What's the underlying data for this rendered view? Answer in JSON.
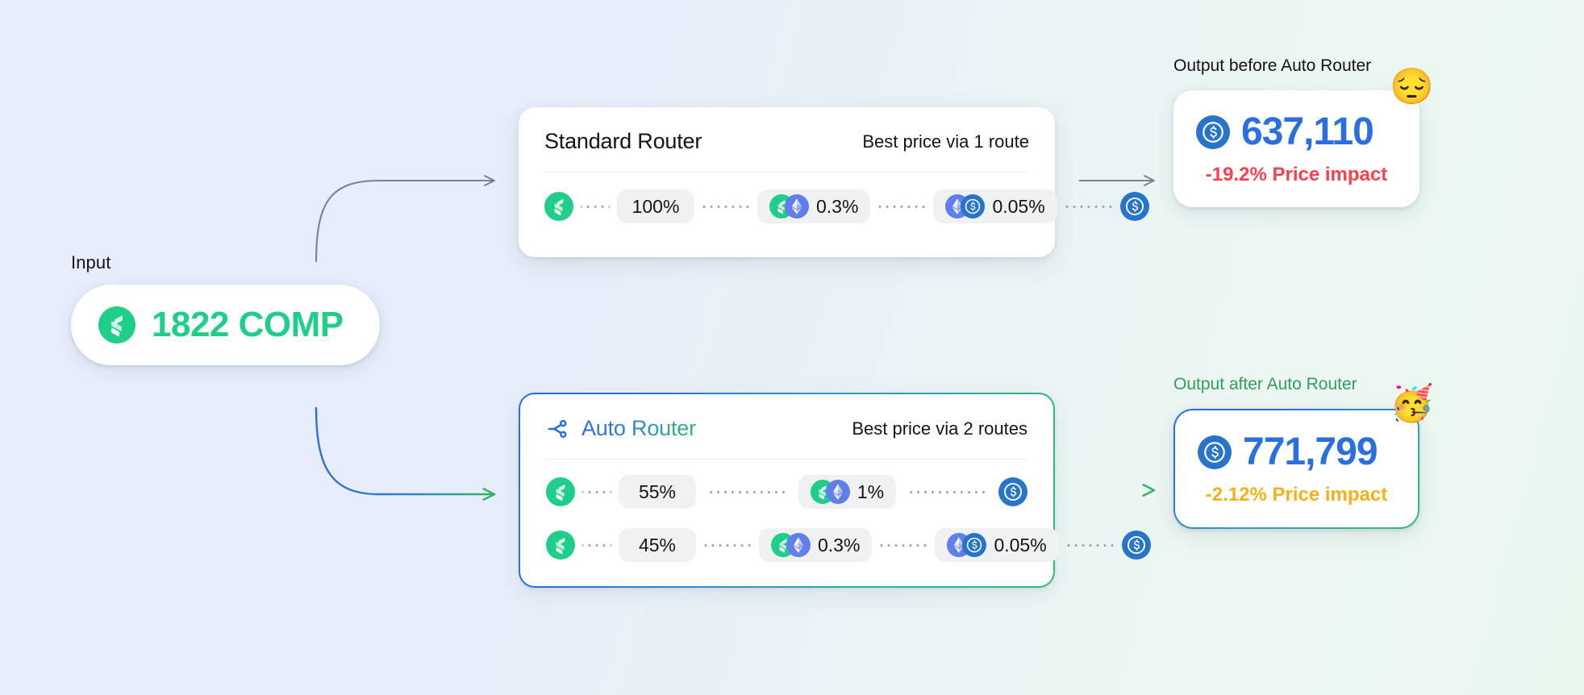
{
  "background": {
    "left_color": "#e7edfb",
    "right_color": "#eaf7ef"
  },
  "input": {
    "label": "Input",
    "amount": "1822 COMP",
    "token_icon": "comp-token-icon"
  },
  "standard_router": {
    "title": "Standard Router",
    "subtitle": "Best price via 1 route",
    "routes": [
      {
        "start_icon": "comp-token-icon",
        "share": "100%",
        "hops": [
          {
            "icons": [
              "comp-token-icon",
              "eth-token-icon"
            ],
            "fee": "0.3%"
          },
          {
            "icons": [
              "eth-token-icon",
              "usdc-token-icon"
            ],
            "fee": "0.05%"
          }
        ],
        "end_icon": "usdc-token-icon"
      }
    ]
  },
  "auto_router": {
    "title": "Auto Router",
    "title_icon": "share-split-icon",
    "subtitle": "Best price via 2 routes",
    "accent_start": "#2a6fe0",
    "accent_end": "#2fbf6e",
    "routes": [
      {
        "start_icon": "comp-token-icon",
        "share": "55%",
        "hops": [
          {
            "icons": [
              "comp-token-icon",
              "eth-token-icon"
            ],
            "fee": "1%"
          }
        ],
        "end_icon": "usdc-token-icon"
      },
      {
        "start_icon": "comp-token-icon",
        "share": "45%",
        "hops": [
          {
            "icons": [
              "comp-token-icon",
              "eth-token-icon"
            ],
            "fee": "0.3%"
          },
          {
            "icons": [
              "eth-token-icon",
              "usdc-token-icon"
            ],
            "fee": "0.05%"
          }
        ],
        "end_icon": "usdc-token-icon"
      }
    ]
  },
  "output_before": {
    "label": "Output before Auto Router",
    "amount": "637,110",
    "token_icon": "usdc-token-icon",
    "price_impact": "-19.2% Price impact",
    "impact_color": "#fb3f4d",
    "emoji": "😔"
  },
  "output_after": {
    "label": "Output after Auto Router",
    "amount": "771,799",
    "token_icon": "usdc-token-icon",
    "price_impact": "-2.12% Price impact",
    "impact_color": "#f5b217",
    "emoji": "🥳"
  },
  "connectors": {
    "input_to_standard": "gray-curved-arrow",
    "input_to_auto": "gradient-curved-arrow",
    "standard_to_output": "gray-straight-arrow",
    "auto_to_output": "gradient-straight-arrow"
  }
}
